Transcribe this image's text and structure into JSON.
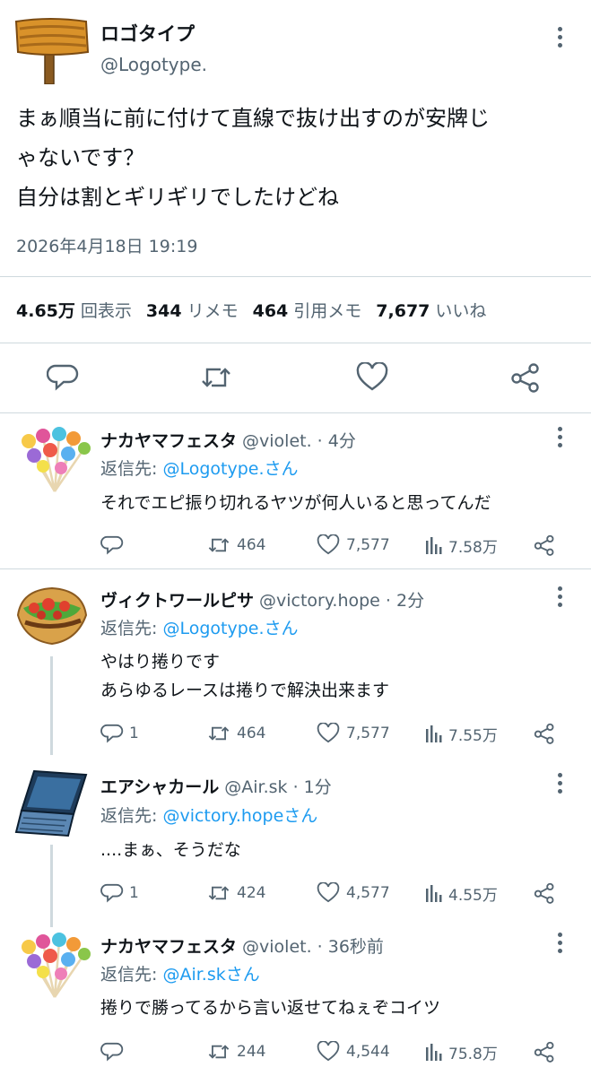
{
  "main": {
    "name": "ロゴタイプ",
    "handle": "@Logotype.",
    "text_lines": [
      "まぁ順当に前に付けて直線で抜け出すのが安牌じ",
      "ゃないです？",
      "自分は割とギリギリでしたけどね"
    ],
    "timestamp": "2026年4月18日 19:19",
    "stats": {
      "views_value": "4.65万",
      "views_label": "回表示",
      "remember_value": "344",
      "remember_label": "リメモ",
      "quote_value": "464",
      "quote_label": "引用メモ",
      "likes_value": "7,677",
      "likes_label": "いいね"
    }
  },
  "replies": [
    {
      "name": "ナカヤマフェスタ",
      "handle": "@violet. · 4分",
      "reply_prefix": "返信先: ",
      "reply_to": "@Logotype.さん",
      "text_lines": [
        "それでエピ振り切れるヤツが何人いると思ってんだ"
      ],
      "reply_count": "",
      "repost_count": "464",
      "like_count": "7,577",
      "view_count": "7.58万"
    },
    {
      "name": "ヴィクトワールピサ",
      "handle": "@victory.hope · 2分",
      "reply_prefix": "返信先: ",
      "reply_to": "@Logotype.さん",
      "text_lines": [
        "やはり捲りです",
        "あらゆるレースは捲りで解決出来ます"
      ],
      "reply_count": "1",
      "repost_count": "464",
      "like_count": "7,577",
      "view_count": "7.55万"
    },
    {
      "name": "エアシャカール",
      "handle": "@Air.sk · 1分",
      "reply_prefix": "返信先: ",
      "reply_to": "@victory.hopeさん",
      "text_lines": [
        "....まぁ、そうだな"
      ],
      "reply_count": "1",
      "repost_count": "424",
      "like_count": "4,577",
      "view_count": "4.55万"
    },
    {
      "name": "ナカヤマフェスタ",
      "handle": "@violet. · 36秒前",
      "reply_prefix": "返信先: ",
      "reply_to": "@Air.skさん",
      "text_lines": [
        "捲りで勝ってるから言い返せてねぇぞコイツ"
      ],
      "reply_count": "",
      "repost_count": "244",
      "like_count": "4,544",
      "view_count": "75.8万"
    }
  ],
  "icons": {
    "reply": "speech-bubble-icon",
    "repost": "repost-arrows-icon",
    "like": "heart-icon",
    "views": "bar-chart-icon",
    "share": "share-nodes-icon",
    "more": "vertical-ellipsis-icon"
  },
  "colors": {
    "text": "#0f1419",
    "secondary": "#536471",
    "link": "#1d9bf0",
    "divider": "#cfd9de"
  }
}
